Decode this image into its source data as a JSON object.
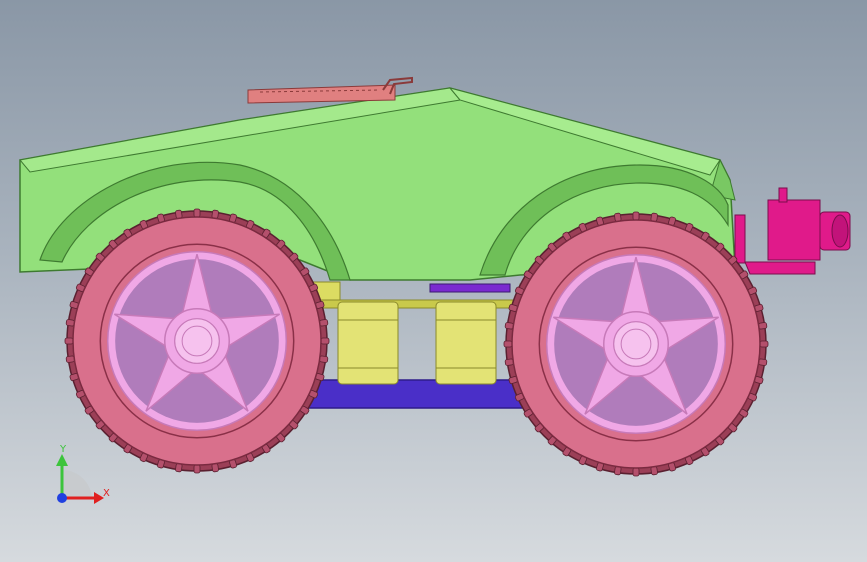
{
  "viewport": {
    "background_top": "#8a97a6",
    "background_bottom": "#d6dade"
  },
  "model": {
    "colors": {
      "body": "#93e07b",
      "body_dark": "#6fbf58",
      "body_edge": "#4f8f3d",
      "tire": "#d9708c",
      "tire_dark": "#9b3f57",
      "rim": "#f0a8e6",
      "rim_dark": "#c77ab9",
      "frame": "#dcdc62",
      "frame_dark": "#b3b23f",
      "chassis": "#4a2fc8",
      "chassis_dark": "#2e1c8a",
      "accent_magenta": "#e01a8a",
      "board": "#e08080"
    }
  },
  "triad": {
    "y_label": "Y",
    "x_label": "X",
    "y_color": "#3cc43c",
    "x_color": "#e02020",
    "z_color": "#2040e0"
  }
}
